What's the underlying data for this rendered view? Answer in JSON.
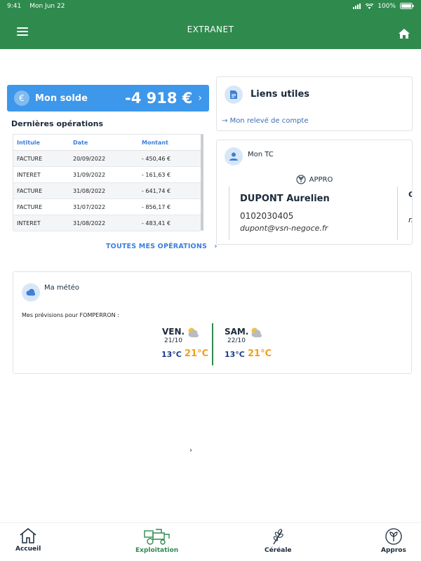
{
  "status_bar": {
    "time": "9:41",
    "date": "Mon Jun 22",
    "battery": "100%"
  },
  "header": {
    "title": "EXTRANET"
  },
  "solde": {
    "label": "Mon solde",
    "amount": "-4 918 €",
    "icon": "euro-icon"
  },
  "operations": {
    "title": "Dernières opérations",
    "columns": [
      "Intitule",
      "Date",
      "Montant"
    ],
    "rows": [
      [
        "FACTURE",
        "20/09/2022",
        "- 450,46 €"
      ],
      [
        "INTERET",
        "31/09/2022",
        "- 161,63 €"
      ],
      [
        "FACTURE",
        "31/08/2022",
        "- 641,74 €"
      ],
      [
        "FACTURE",
        "31/07/2022",
        "- 856,17 €"
      ],
      [
        "INTERET",
        "31/08/2022",
        "- 483,41 €"
      ]
    ],
    "all_link": "TOUTES MES OPÉRATIONS"
  },
  "liens": {
    "title": "Liens utiles",
    "link": "Mon relevé de compte"
  },
  "tc": {
    "title": "Mon TC",
    "category": "APPRO",
    "name": "DUPONT Aurelien",
    "phone": "0102030405",
    "email": "dupont@vsn-negoce.fr",
    "next_initial": "G",
    "next_email_initial": "n"
  },
  "meteo": {
    "title": "Ma météo",
    "forecast_label": "Mes prévisions pour FOMPERRON :",
    "days": [
      {
        "name": "VEN.",
        "date": "21/10",
        "min": "13°C",
        "max": "21°C"
      },
      {
        "name": "SAM.",
        "date": "22/10",
        "min": "13°C",
        "max": "21°C"
      }
    ]
  },
  "middle_chevron": "›",
  "tabs": {
    "accueil": "Accueil",
    "exploitation": "Exploitation",
    "cereale": "Céréale",
    "appros": "Appros"
  },
  "colors": {
    "brand_green": "#2f8a4e",
    "accent_blue": "#3d97ea",
    "temp_max": "#f0a020",
    "temp_min": "#1f3c88"
  }
}
